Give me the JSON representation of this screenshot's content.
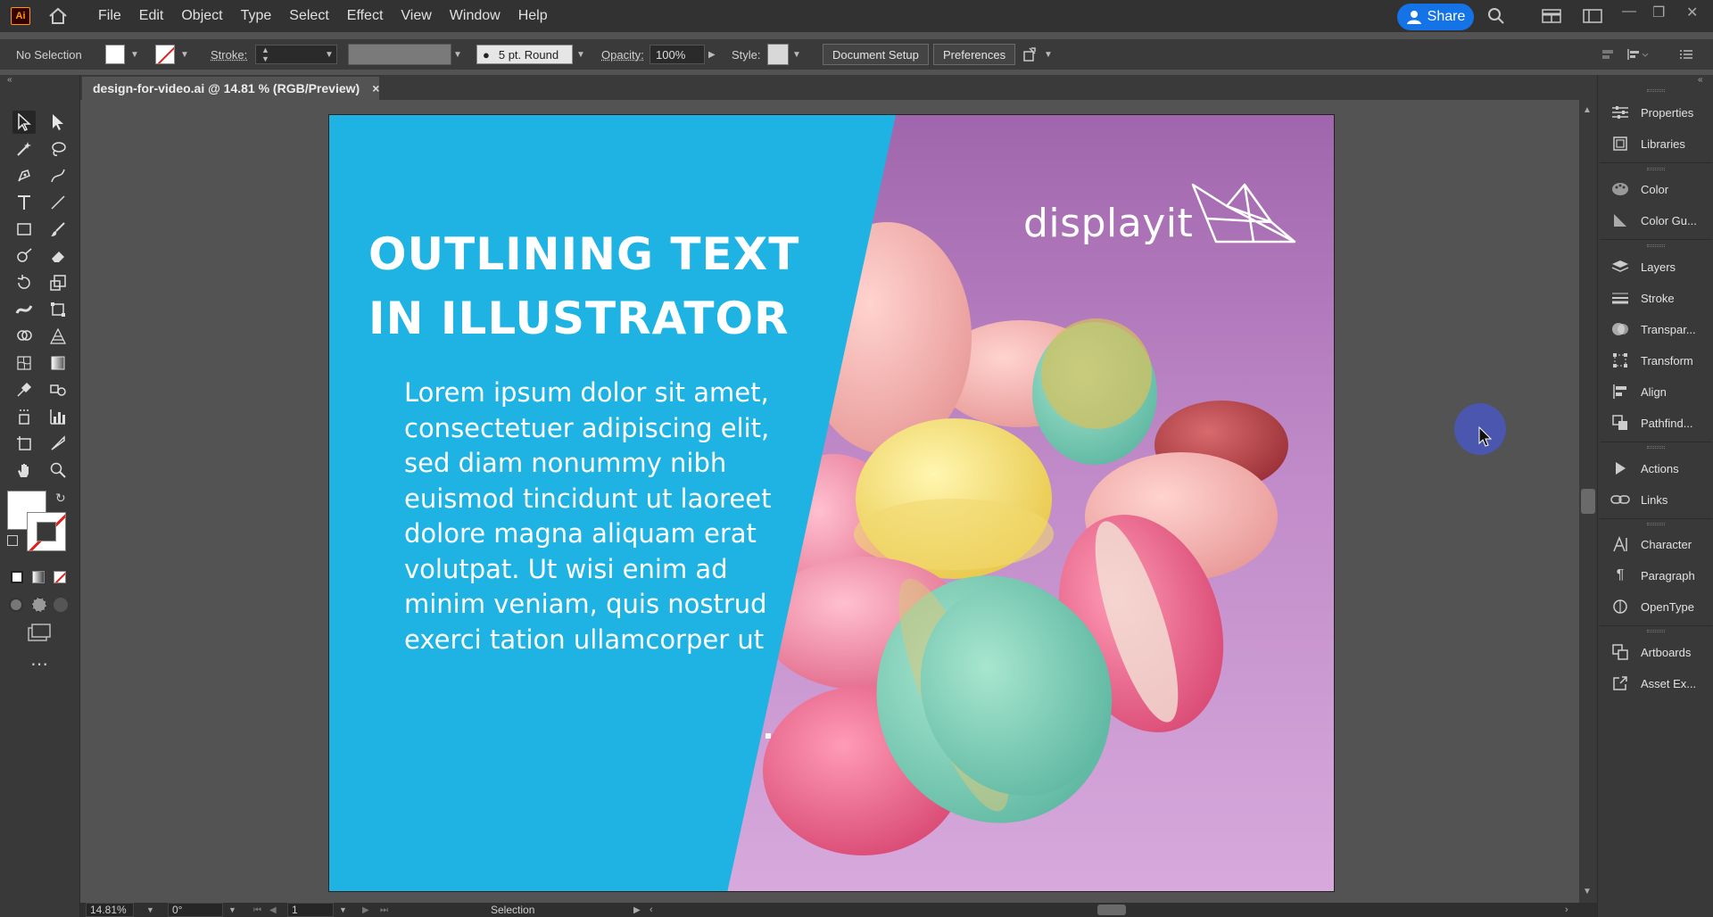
{
  "app": {
    "logo": "Ai",
    "menus": [
      "File",
      "Edit",
      "Object",
      "Type",
      "Select",
      "Effect",
      "View",
      "Window",
      "Help"
    ],
    "share_label": "Share"
  },
  "control_bar": {
    "selection_label": "No Selection",
    "stroke_label": "Stroke:",
    "brush_label": "5 pt. Round",
    "opacity_label": "Opacity:",
    "opacity_value": "100%",
    "style_label": "Style:",
    "document_setup": "Document Setup",
    "preferences": "Preferences"
  },
  "document_tab": {
    "title": "design-for-video.ai @ 14.81 % (RGB/Preview)",
    "close": "×"
  },
  "artboard": {
    "headline_line1": "OUTLINING TEXT",
    "headline_line2": "IN ILLUSTRATOR",
    "body": "Lorem ipsum dolor sit amet, consectetuer adipiscing elit, sed diam nonummy nibh euismod tincidunt ut laoreet dolore magna aliquam erat volutpat. Ut wisi enim ad minim veniam, quis nostrud exerci tation ullamcorper ut",
    "brand": "displayit",
    "panel_color": "#1fb3e3"
  },
  "status_bar": {
    "zoom": "14.81%",
    "rotation": "0°",
    "artboard_number": "1",
    "tool_name": "Selection"
  },
  "right_panel": {
    "items": [
      {
        "label": "Properties",
        "icon": "sliders-icon"
      },
      {
        "label": "Libraries",
        "icon": "libraries-icon"
      },
      {
        "label": "Color",
        "icon": "palette-icon"
      },
      {
        "label": "Color Gu...",
        "icon": "color-guide-icon"
      },
      {
        "label": "Layers",
        "icon": "layers-icon"
      },
      {
        "label": "Stroke",
        "icon": "stroke-icon"
      },
      {
        "label": "Transpar...",
        "icon": "transparency-icon"
      },
      {
        "label": "Transform",
        "icon": "transform-icon"
      },
      {
        "label": "Align",
        "icon": "align-icon"
      },
      {
        "label": "Pathfind...",
        "icon": "pathfinder-icon"
      },
      {
        "label": "Actions",
        "icon": "play-icon"
      },
      {
        "label": "Links",
        "icon": "link-icon"
      },
      {
        "label": "Character",
        "icon": "character-icon"
      },
      {
        "label": "Paragraph",
        "icon": "pilcrow-icon"
      },
      {
        "label": "OpenType",
        "icon": "opentype-icon"
      },
      {
        "label": "Artboards",
        "icon": "artboards-icon"
      },
      {
        "label": "Asset Ex...",
        "icon": "export-icon"
      }
    ]
  },
  "colors": {
    "accent": "#1473e6",
    "logo_orange": "#ff9a00",
    "cyan_panel": "#1fb3e3",
    "photo_purple": "#b07ab8"
  }
}
